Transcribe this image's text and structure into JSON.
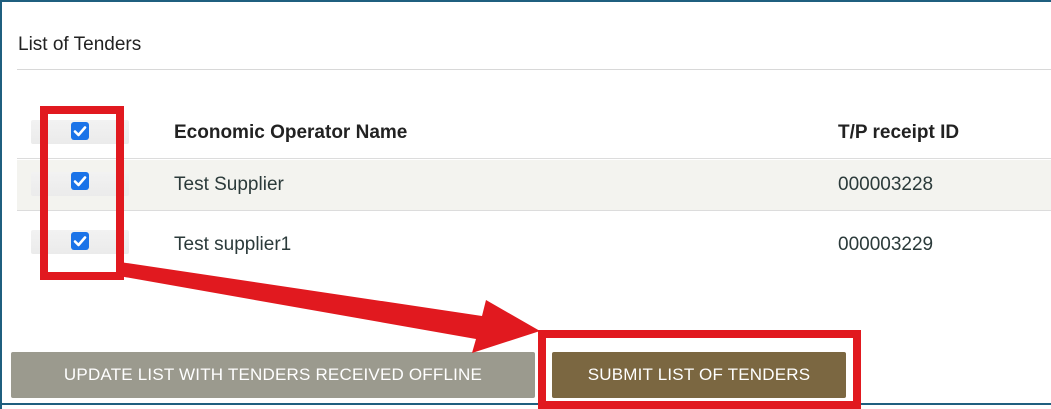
{
  "panel": {
    "title": "List of Tenders"
  },
  "table": {
    "headers": {
      "name": "Economic Operator Name",
      "id": "T/P receipt ID"
    },
    "rows": [
      {
        "name": "Test Supplier",
        "id": "000003228",
        "checked": true
      },
      {
        "name": "Test supplier1",
        "id": "000003229",
        "checked": true
      }
    ]
  },
  "buttons": {
    "update": "UPDATE LIST WITH TENDERS RECEIVED OFFLINE",
    "submit": "SUBMIT LIST OF TENDERS"
  },
  "colors": {
    "annotation": "#e1191f",
    "checkbox": "#1a73e8",
    "submit_button": "#7b6741",
    "update_button": "#9b9a8e"
  }
}
